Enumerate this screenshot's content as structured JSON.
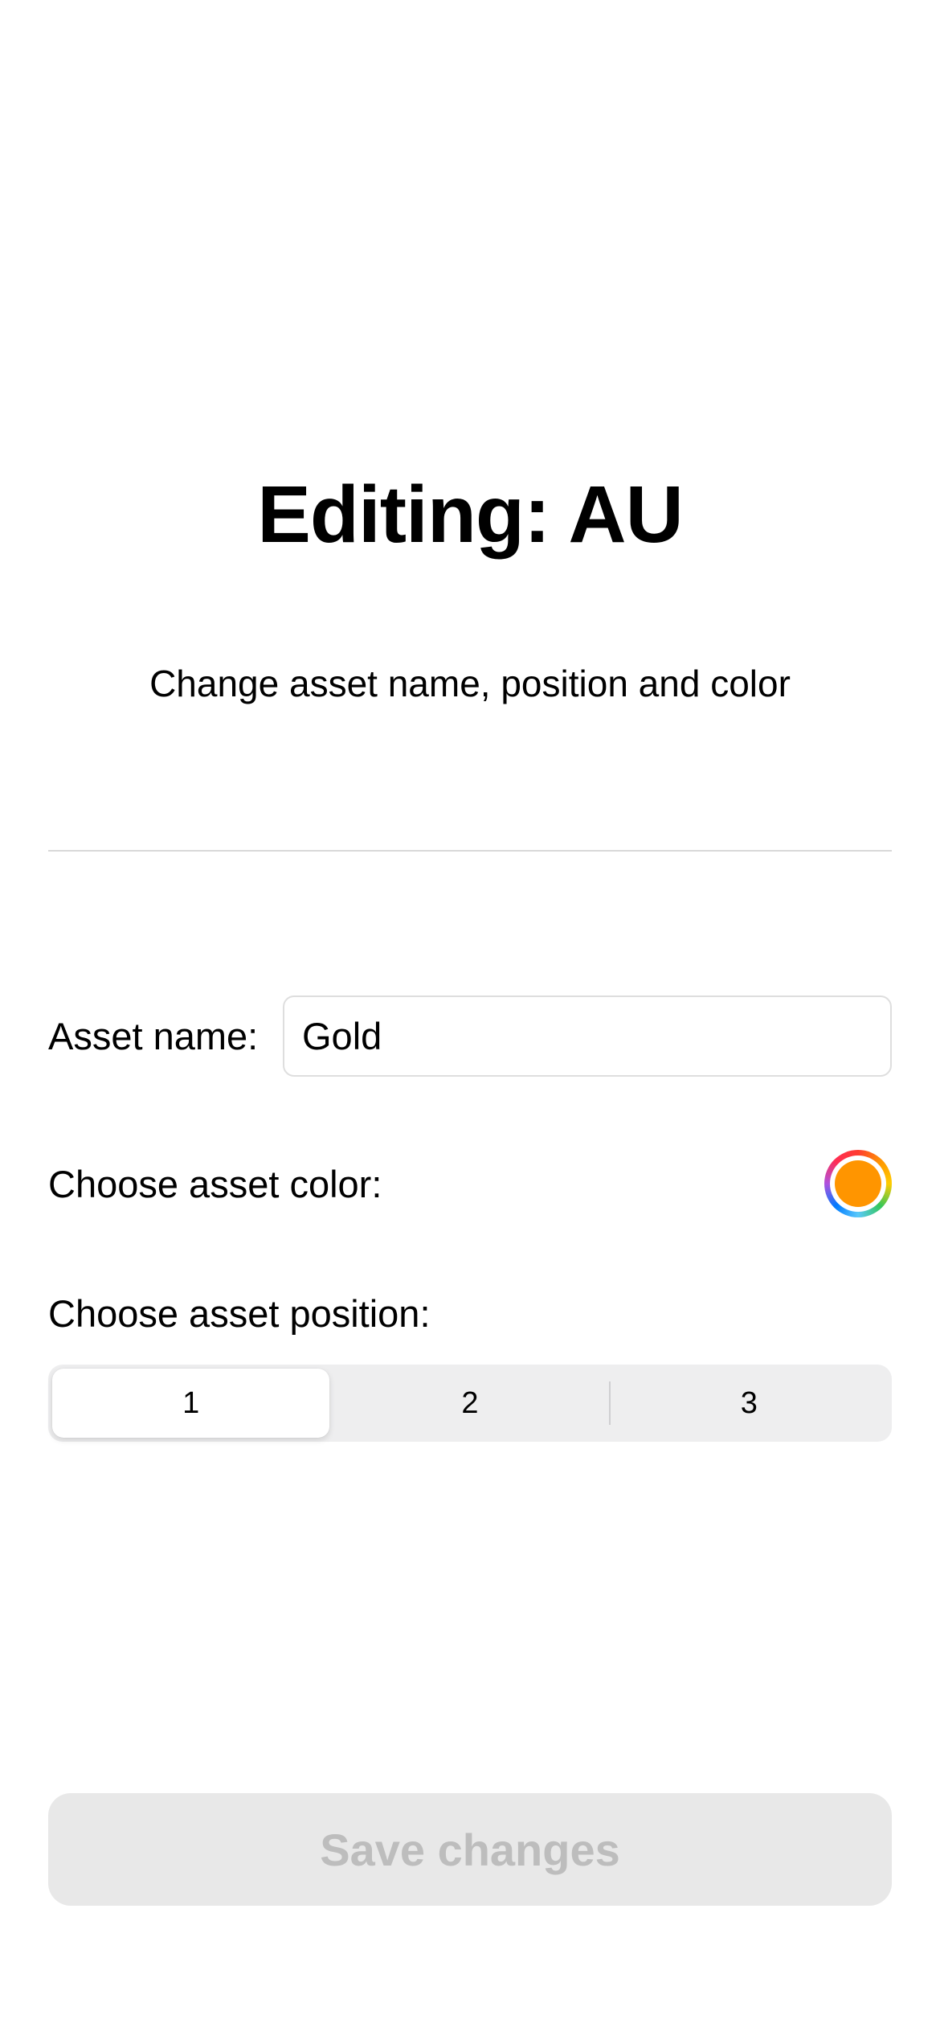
{
  "header": {
    "title": "Editing: AU",
    "subtitle": "Change asset name, position and color"
  },
  "form": {
    "name_label": "Asset name:",
    "name_value": "Gold",
    "color_label": "Choose asset color:",
    "color_value": "#ff9500",
    "position_label": "Choose asset position:",
    "positions": [
      "1",
      "2",
      "3"
    ],
    "selected_position": "1"
  },
  "actions": {
    "save_label": "Save changes",
    "save_enabled": false
  },
  "colors": {
    "divider": "#d9d9d9",
    "segment_track": "#eeeeef",
    "button_disabled_bg": "#e8e8e8",
    "button_disabled_text": "#bdbdbd"
  }
}
